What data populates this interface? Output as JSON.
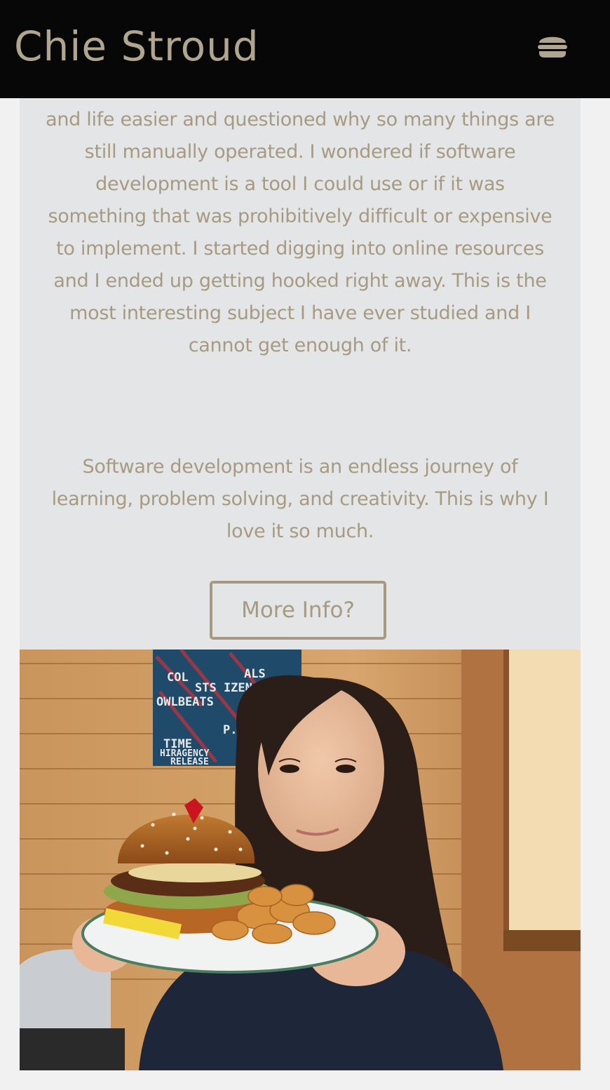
{
  "header": {
    "title": "Chie Stroud",
    "menu_icon": "hamburger-menu-icon",
    "background": "#070707",
    "text_color": "#b0a58e"
  },
  "about": {
    "paragraph1": "and life easier and questioned why so many things are still manually operated. I wondered if software development is a tool I could use or if it was something that was prohibitively difficult or expensive to implement. I started digging into online resources and I ended up getting hooked right away. This is the most interesting subject I have ever studied and I cannot get enough of it.",
    "paragraph2": "Software development is an endless journey of learning, problem solving, and creativity. This is why I love it so much.",
    "more_info_label": "More Info?",
    "text_color": "#a69a82",
    "panel_background": "#e4e5e6"
  },
  "photo": {
    "description_icon": "profile-photo",
    "poster_lines": [
      "COL",
      "ALS",
      "STS IZEN EN",
      "OWLBEATS",
      "P.D",
      "TIME",
      "HIRAGENCY",
      "RELEASE"
    ]
  }
}
